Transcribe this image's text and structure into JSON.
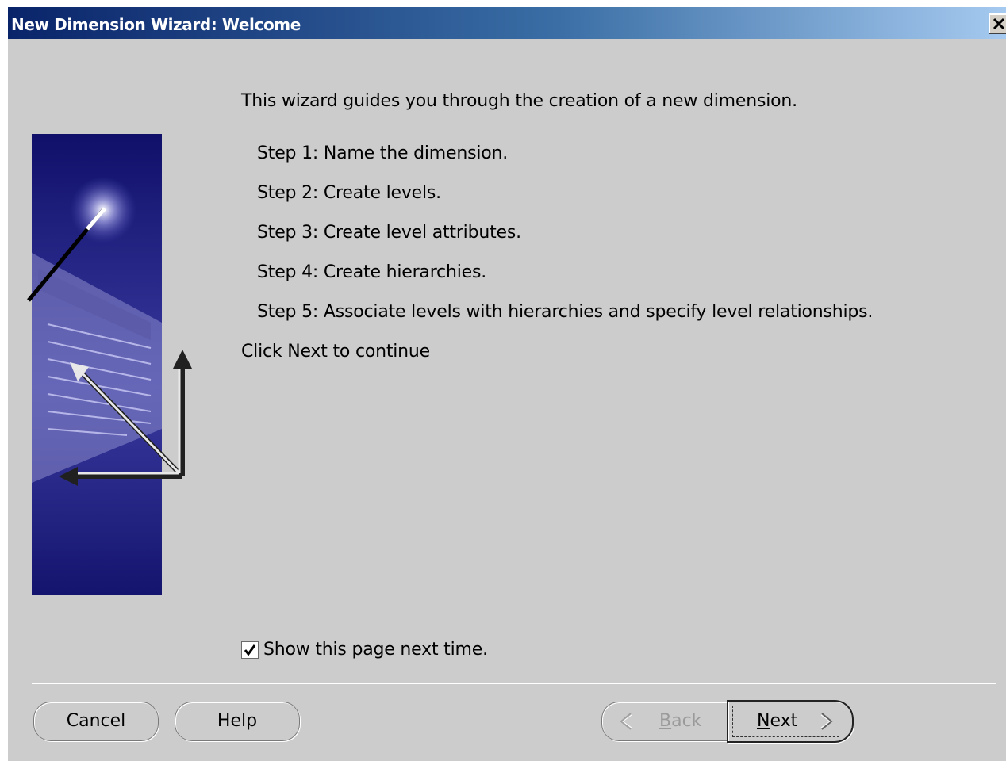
{
  "window": {
    "title": "New Dimension Wizard: Welcome",
    "close_icon": "close-icon"
  },
  "content": {
    "intro": "This wizard guides you through the creation of a new dimension.",
    "steps": [
      "Step 1: Name the dimension.",
      "Step 2: Create levels.",
      "Step 3: Create level attributes.",
      "Step 4: Create hierarchies.",
      "Step 5: Associate levels with hierarchies and specify level relationships."
    ],
    "continue_text": "Click Next to continue"
  },
  "options": {
    "show_next_time_label": "Show this page next time.",
    "show_next_time_checked": true
  },
  "buttons": {
    "cancel": "Cancel",
    "help": "Help",
    "back_mnemonic": "B",
    "back_rest": "ack",
    "back_enabled": false,
    "next_mnemonic": "N",
    "next_rest": "ext"
  },
  "colors": {
    "title_gradient_start": "#0a246a",
    "title_gradient_end": "#a6caf0",
    "dialog_background": "#cccccc",
    "image_background": "#14146e"
  }
}
